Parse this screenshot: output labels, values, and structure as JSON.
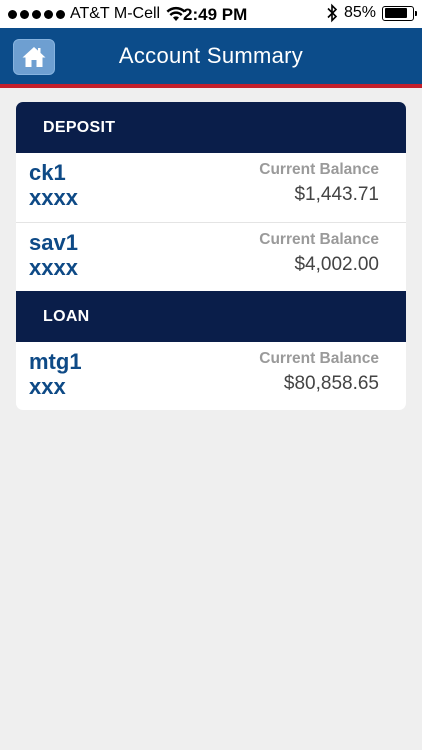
{
  "status_bar": {
    "carrier": "AT&T M-Cell",
    "time": "2:49 PM",
    "battery_percent": "85%",
    "battery_level": 0.85
  },
  "nav": {
    "title": "Account Summary",
    "home_icon": "home-icon",
    "bar_color": "#0c4c8a",
    "accent_line_color": "#c41f2b"
  },
  "sections": [
    {
      "header": "DEPOSIT",
      "accounts": [
        {
          "name": "ck1",
          "number": "xxxx",
          "balance_label": "Current Balance",
          "balance": "$1,443.71"
        },
        {
          "name": "sav1",
          "number": "xxxx",
          "balance_label": "Current Balance",
          "balance": "$4,002.00"
        }
      ]
    },
    {
      "header": "LOAN",
      "accounts": [
        {
          "name": "mtg1",
          "number": "xxx",
          "balance_label": "Current Balance",
          "balance": "$80,858.65"
        }
      ]
    }
  ]
}
